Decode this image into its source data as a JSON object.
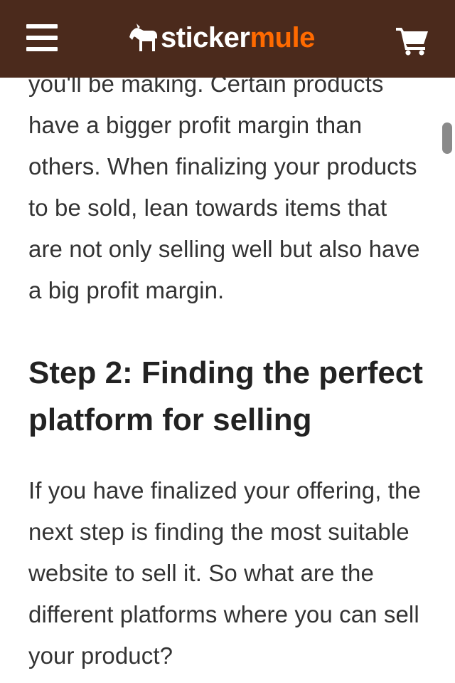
{
  "header": {
    "logo_text_primary": "sticker",
    "logo_text_accent": "mule",
    "brand_color": "#4b2a1c",
    "accent_color": "#ff6a00",
    "menu_icon": "hamburger-menu-icon",
    "cart_icon": "shopping-cart-icon"
  },
  "article": {
    "paragraph_1": "you'll be making. Certain products have a bigger profit margin than others. When finalizing your products to be sold, lean towards items that are not only selling well but also have a big profit margin.",
    "heading_step2": "Step 2: Finding the perfect platform for selling",
    "paragraph_2": "If you have finalized your offering, the next step is finding the most suitable website to sell it. So what are the different platforms where you can sell your product?"
  }
}
